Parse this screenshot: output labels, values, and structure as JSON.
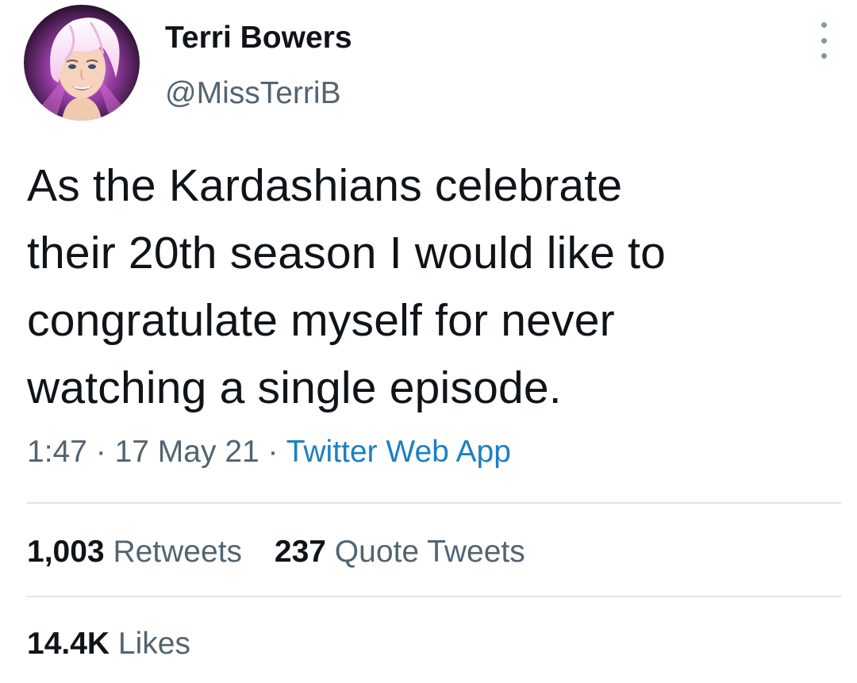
{
  "tweet": {
    "author": {
      "display_name": "Terri Bowers",
      "handle": "@MissTerriB"
    },
    "more_icon": "vertical-ellipsis-icon",
    "text_lines": [
      "As the Kardashians celebrate",
      "their 20th season I would like to",
      "congratulate myself for never",
      "watching a single episode."
    ],
    "time": "1:47",
    "date": "17 May 21",
    "separator": "·",
    "source": "Twitter Web App",
    "retweets": {
      "count": "1,003",
      "label": "Retweets"
    },
    "quote_tweets": {
      "count": "237",
      "label": "Quote Tweets"
    },
    "likes": {
      "count": "14.4K",
      "label": "Likes"
    }
  },
  "colors": {
    "primary_text": "#0f1419",
    "secondary_text": "#536471",
    "link": "#1d7fc4",
    "divider": "#e1e5e8"
  }
}
